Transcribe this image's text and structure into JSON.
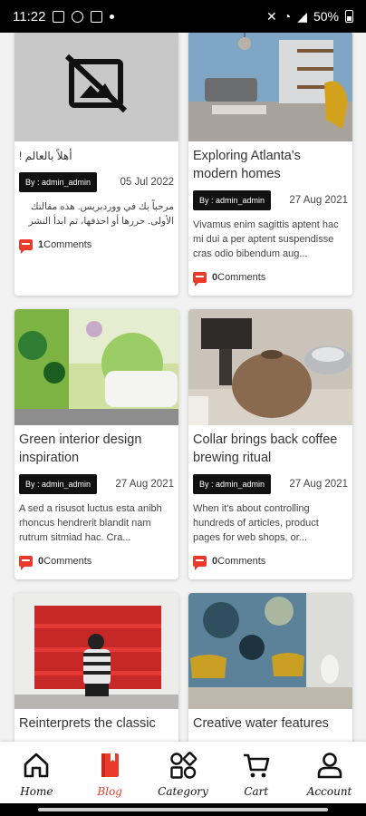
{
  "status_bar": {
    "time": "11:22",
    "battery": "50%"
  },
  "posts": [
    {
      "title": "أهلاً بالعالم !",
      "author": "By : admin_admin",
      "date": "05 Jul 2022",
      "excerpt": "مرحباً بك في ووردبريس. هذه مقالتك الأولى. حررها أو احذفها، ثم ابدأ النشر",
      "comments_count": "1",
      "comments_label": "Comments",
      "rtl": true,
      "image": "placeholder"
    },
    {
      "title": "Exploring Atlanta's modern homes",
      "author": "By : admin_admin",
      "date": "27 Aug 2021",
      "excerpt": "Vivamus enim sagittis aptent hac mi dui a per aptent suspendisse cras odio bibendum aug...",
      "comments_count": "0",
      "comments_label": "Comments",
      "rtl": false,
      "image": "living-room"
    },
    {
      "title": "Green interior design inspiration",
      "author": "By : admin_admin",
      "date": "27 Aug 2021",
      "excerpt": "A sed a risusot luctus esta anibh rhoncus hendrerit blandit nam rutrum sitmiad hac. Cra...",
      "comments_count": "0",
      "comments_label": "Comments",
      "rtl": false,
      "image": "green-interior"
    },
    {
      "title": "Collar brings back coffee brewing ritual",
      "author": "By : admin_admin",
      "date": "27 Aug 2021",
      "excerpt": "When it's about controlling hundreds of articles, product pages for web shops, or...",
      "comments_count": "0",
      "comments_label": "Comments",
      "rtl": false,
      "image": "coffee-vessels"
    },
    {
      "title": "Reinterprets the classic",
      "image": "red-shelves"
    },
    {
      "title": "Creative water features",
      "image": "lounge-chairs"
    }
  ],
  "nav": [
    {
      "label": "Home",
      "icon": "home-icon",
      "active": false
    },
    {
      "label": "Blog",
      "icon": "blog-book-icon",
      "active": true
    },
    {
      "label": "Category",
      "icon": "category-icon",
      "active": false
    },
    {
      "label": "Cart",
      "icon": "cart-icon",
      "active": false
    },
    {
      "label": "Account",
      "icon": "account-icon",
      "active": false
    }
  ],
  "colors": {
    "accent": "#ea3a2c",
    "badge": "#111111",
    "background": "#f2f2f2"
  }
}
